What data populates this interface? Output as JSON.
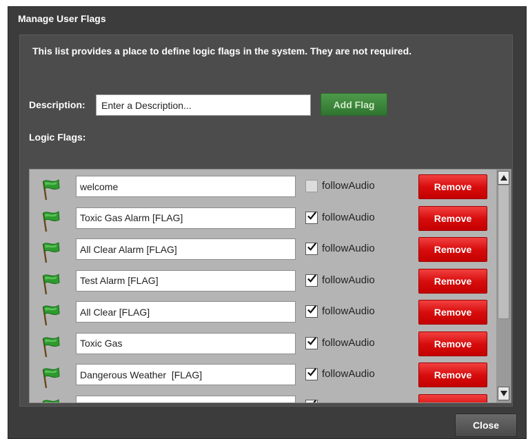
{
  "dialog": {
    "title": "Manage User Flags",
    "intro": "This list provides a place to define logic flags in the system. They are not required.",
    "description_label": "Description:",
    "description_placeholder": "Enter a Description...",
    "add_button": "Add Flag",
    "flags_label": "Logic Flags:",
    "close_button": "Close"
  },
  "flags": [
    {
      "name": "welcome",
      "follow_audio": false,
      "checkbox_label": "followAudio",
      "remove_label": "Remove"
    },
    {
      "name": "Toxic Gas Alarm [FLAG]",
      "follow_audio": true,
      "checkbox_label": "followAudio",
      "remove_label": "Remove"
    },
    {
      "name": "All Clear Alarm [FLAG]",
      "follow_audio": true,
      "checkbox_label": "followAudio",
      "remove_label": "Remove"
    },
    {
      "name": "Test Alarm [FLAG]",
      "follow_audio": true,
      "checkbox_label": "followAudio",
      "remove_label": "Remove"
    },
    {
      "name": "All Clear [FLAG]",
      "follow_audio": true,
      "checkbox_label": "followAudio",
      "remove_label": "Remove"
    },
    {
      "name": "Toxic Gas",
      "follow_audio": true,
      "checkbox_label": "followAudio",
      "remove_label": "Remove"
    },
    {
      "name": "Dangerous Weather  [FLAG]",
      "follow_audio": true,
      "checkbox_label": "followAudio",
      "remove_label": "Remove"
    },
    {
      "name": "",
      "follow_audio": true,
      "checkbox_label": "",
      "remove_label": ""
    }
  ],
  "icons": {
    "flag": "green-flag-icon",
    "check": "checkmark-icon",
    "scroll_up": "arrow-up-icon",
    "scroll_down": "arrow-down-icon"
  },
  "colors": {
    "dialog_bg": "#3c3c3c",
    "panel_bg": "#4c4c4c",
    "list_bg": "#b4b4b4",
    "add_button": "#3f8a3c",
    "remove_button": "#d80d0d",
    "flag_green": "#2e9a2e"
  }
}
